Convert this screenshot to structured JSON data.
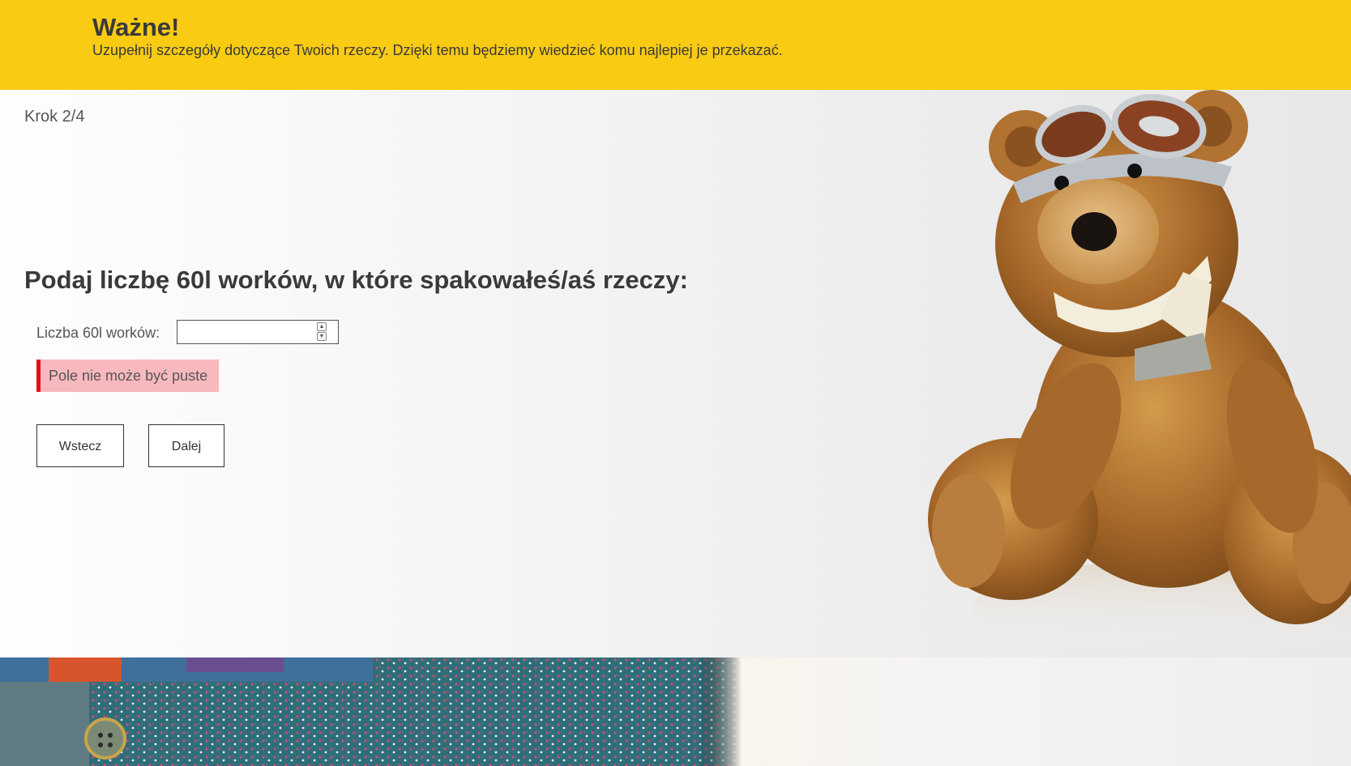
{
  "banner": {
    "title": "Ważne!",
    "text": "Uzupełnij szczegóły dotyczące Twoich rzeczy. Dzięki temu będziemy wiedzieć komu najlepiej je przekazać."
  },
  "form": {
    "step": "Krok 2/4",
    "question": "Podaj liczbę 60l worków, w które spakowałeś/aś rzeczy:",
    "field_label": "Liczba 60l worków:",
    "field_value": "",
    "error_message": "Pole nie może być puste",
    "back_label": "Wstecz",
    "next_label": "Dalej"
  },
  "colors": {
    "banner": "#f9cb13",
    "error_bg": "#f7b9be",
    "error_border": "#e0101a"
  },
  "icons": {
    "spinner_up": "▲",
    "spinner_down": "▼"
  }
}
